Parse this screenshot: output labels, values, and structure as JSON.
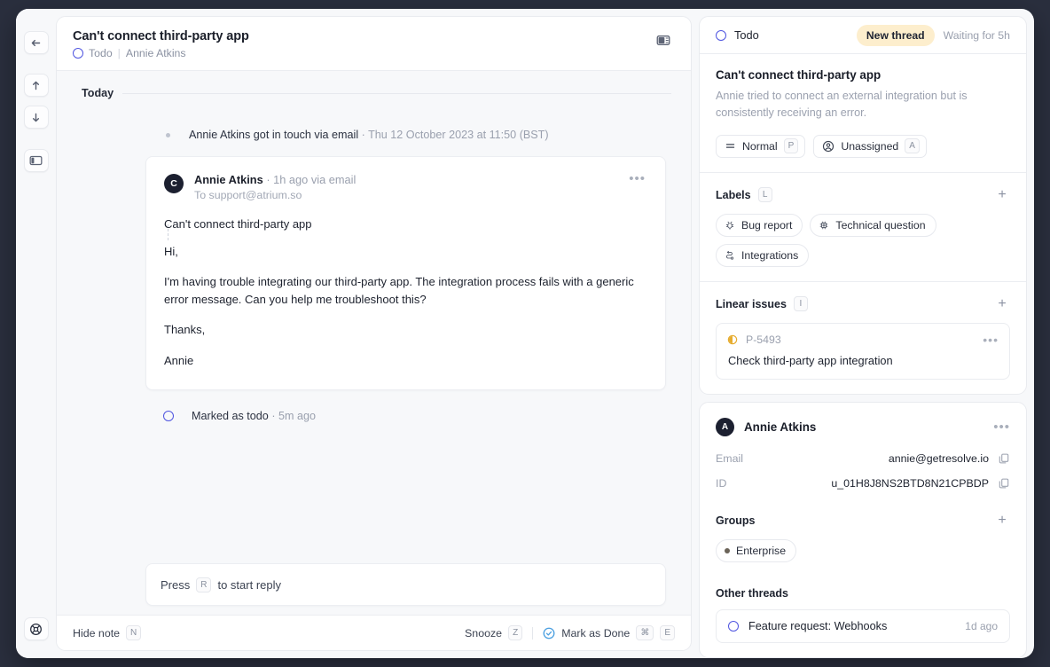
{
  "window": {
    "outer_bg": "#2a2f3e",
    "accent": "#4f55e0",
    "badge_bg": "#fdeecd"
  },
  "rail": {
    "items": [
      {
        "name": "back",
        "icon": "arrow-left-icon"
      },
      {
        "name": "previous",
        "icon": "arrow-up-icon"
      },
      {
        "name": "next",
        "icon": "arrow-down-icon"
      },
      {
        "name": "toggle-sidebar",
        "icon": "panel-left-icon"
      }
    ],
    "bottom": {
      "name": "help",
      "icon": "lifebuoy-icon"
    }
  },
  "thread_header": {
    "title": "Can't connect third-party app",
    "status": "Todo",
    "assignee": "Annie Atkins",
    "separator": "|",
    "toggle_panel_icon": "panel-right-icon"
  },
  "timeline": {
    "day_label": "Today",
    "events": [
      {
        "text": "Annie Atkins got in touch via email",
        "meta": "· Thu 12 October 2023 at 11:50 (BST)",
        "marker": "dot"
      },
      {
        "text": "Marked as todo",
        "meta": "· 5m ago",
        "marker": "ring"
      }
    ],
    "message": {
      "avatar_initial": "C",
      "author": "Annie Atkins",
      "meta": "· 1h ago via email",
      "recipient": "To support@atrium.so",
      "subject": "Can't connect third-party app",
      "paragraphs": [
        "Hi,",
        "I'm having trouble integrating our third-party app. The integration process fails with a generic error message. Can you help me troubleshoot this?",
        "Thanks,",
        "Annie"
      ],
      "more_icon": "ellipsis-icon"
    }
  },
  "composer": {
    "prefix": "Press",
    "key": "R",
    "suffix": "to start reply"
  },
  "bottom_bar": {
    "hide_note_label": "Hide note",
    "hide_note_key": "N",
    "snooze_label": "Snooze",
    "snooze_key": "Z",
    "done_label": "Mark as Done",
    "done_keys": [
      "⌘",
      "E"
    ],
    "done_icon": "check-circle-icon"
  },
  "right_panel": {
    "status": "Todo",
    "badge": "New thread",
    "waiting": "Waiting for 5h",
    "title": "Can't connect third-party app",
    "description": "Annie tried to connect an external integration but is consistently receiving an error.",
    "priority": {
      "label": "Normal",
      "key": "P",
      "icon": "priority-bars-icon"
    },
    "assignee": {
      "label": "Unassigned",
      "key": "A",
      "icon": "user-circle-icon"
    },
    "labels": {
      "section_label": "Labels",
      "section_key": "L",
      "add_icon": "plus-icon",
      "items": [
        {
          "label": "Bug report",
          "icon": "bug-icon"
        },
        {
          "label": "Technical question",
          "icon": "chip-icon"
        },
        {
          "label": "Integrations",
          "icon": "workflow-icon"
        }
      ]
    },
    "linear_issues": {
      "section_label": "Linear issues",
      "section_key": "I",
      "add_icon": "plus-icon",
      "items": [
        {
          "key": "P-5493",
          "title": "Check third-party app integration",
          "status_icon": "half-circle-icon",
          "status_color": "#e6ac2e",
          "more_icon": "ellipsis-icon"
        }
      ]
    },
    "contact": {
      "avatar_initial": "A",
      "name": "Annie Atkins",
      "more_icon": "ellipsis-icon",
      "fields": [
        {
          "key": "Email",
          "value": "annie@getresolve.io",
          "copy_icon": "copy-icon"
        },
        {
          "key": "ID",
          "value": "u_01H8J8NS2BTD8N21CPBDP",
          "copy_icon": "copy-icon"
        }
      ],
      "groups": {
        "section_label": "Groups",
        "add_icon": "plus-icon",
        "items": [
          {
            "label": "Enterprise",
            "dot_color": "#6b6358"
          }
        ]
      },
      "other_threads": {
        "section_label": "Other threads",
        "items": [
          {
            "title": "Feature request: Webhooks",
            "time": "1d ago",
            "status_icon": "todo-ring-icon"
          }
        ]
      }
    }
  }
}
